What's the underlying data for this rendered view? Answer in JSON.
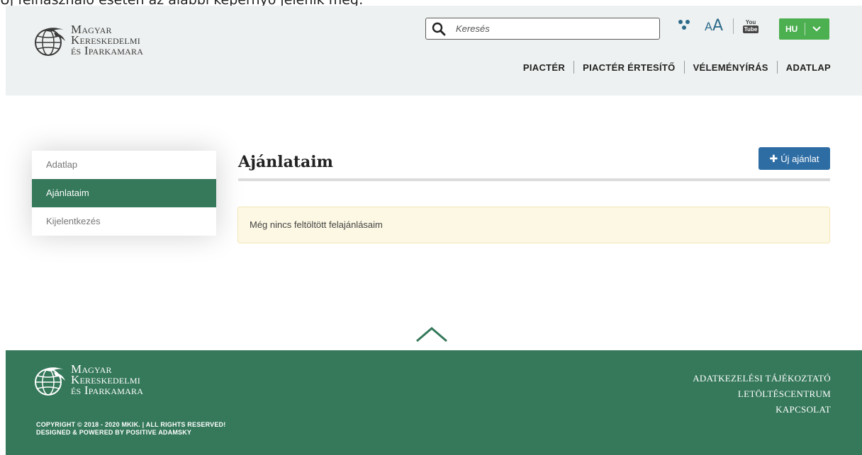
{
  "caption": "Új felhasználó esetén az alábbi képernyő jelenik meg:",
  "brand": {
    "line1": "Magyar",
    "line2": "Kereskedelmi",
    "line3": "és Iparkamara"
  },
  "search": {
    "placeholder": "Keresés"
  },
  "tools": {
    "font_small": "A",
    "font_large": "A",
    "youtube_line1": "You",
    "youtube_line2": "Tube"
  },
  "language": {
    "code": "HU",
    "chevron": "⌄"
  },
  "nav": {
    "items": [
      "PIACTÉR",
      "PIACTÉR ÉRTESÍTŐ",
      "VÉLEMÉNYÍRÁS",
      "ADATLAP"
    ]
  },
  "sidebar": {
    "items": [
      "Adatlap",
      "Ajánlataim",
      "Kijelentkezés"
    ],
    "active_index": 1
  },
  "page": {
    "title": "Ajánlataim",
    "new_button": "Új ajánlat",
    "empty_message": "Még nincs feltöltött felajánlásaim"
  },
  "footer": {
    "links": [
      "ADATKEZELÉSI TÁJÉKOZTATÓ",
      "LETÖLTÉSCENTRUM",
      "KAPCSOLAT"
    ],
    "copyright": "COPYRIGHT © 2018 - 2020 MKIK. | ALL RIGHTS RESERVED!",
    "powered": "DESIGNED & POWERED BY POSITIVE ADAMSKY"
  },
  "colors": {
    "header_bg": "#eef1f1",
    "brand_green": "#35785a",
    "lang_green": "#4caf50",
    "button_blue": "#2e6da4",
    "alert_bg": "#fcf8e3"
  }
}
